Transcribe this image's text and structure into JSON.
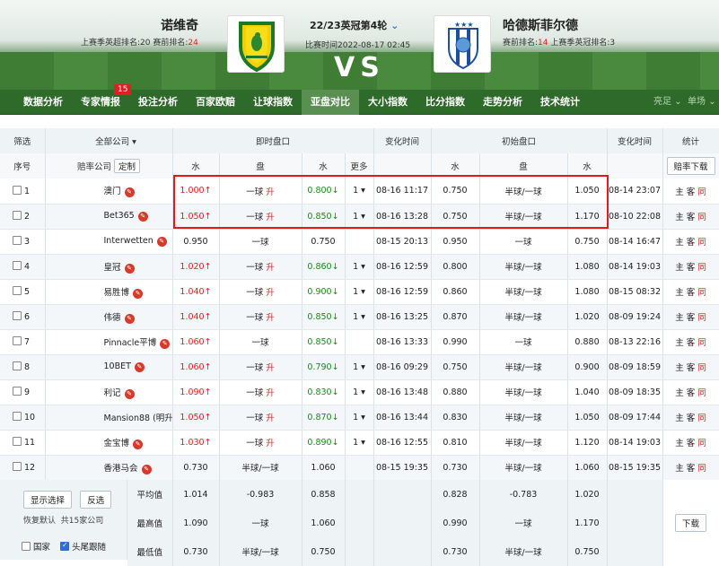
{
  "header": {
    "home_team": "诺维奇",
    "home_rank_prefix": "上赛季英超排名:20",
    "home_rank_label": "赛前排名:",
    "home_rank_value": "24",
    "away_team": "哈德斯菲尔德",
    "away_rank_label": "赛前排名:",
    "away_rank_value": "14",
    "away_rank_suffix": "上赛季英冠排名:3",
    "match_title": "22/23英冠第4轮",
    "match_time": "比赛时间2022-08-17 02:45",
    "vs": "VS"
  },
  "nav": {
    "items": [
      "数据分析",
      "专家情报",
      "投注分析",
      "百家欧赔",
      "让球指数",
      "亚盘对比",
      "大小指数",
      "比分指数",
      "走势分析",
      "技术统计"
    ],
    "active_index": 5,
    "badge": "15",
    "right_1": "亮足",
    "right_2": "单场"
  },
  "table": {
    "h_filter": "筛选",
    "h_company_select": "全部公司",
    "h_live": "即时盘口",
    "h_change_time": "变化时间",
    "h_initial": "初始盘口",
    "h_change_time2": "变化时间",
    "h_stats": "统计",
    "h_no": "序号",
    "h_company": "赔率公司",
    "h_custom": "定制",
    "h_water": "水",
    "h_handicap": "盘",
    "h_water2": "水",
    "h_more": "更多",
    "h_water3": "水",
    "h_handicap2": "盘",
    "h_water4": "水",
    "h_download": "赔率下载",
    "rows": [
      {
        "no": "1",
        "company": "澳门",
        "w1": "1.000↑",
        "p": "一球",
        "p_arrow": "升",
        "w2": "0.800↓",
        "more": "1",
        "time": "08-16 11:17",
        "iw1": "0.750",
        "ip": "半球/一球",
        "iw2": "1.050",
        "itime": "08-14 23:07"
      },
      {
        "no": "2",
        "company": "Bet365",
        "w1": "1.050↑",
        "p": "一球",
        "p_arrow": "升",
        "w2": "0.850↓",
        "more": "1",
        "time": "08-16 13:28",
        "iw1": "0.750",
        "ip": "半球/一球",
        "iw2": "1.170",
        "itime": "08-10 22:08"
      },
      {
        "no": "3",
        "company": "Interwetten",
        "w1": "0.950",
        "p": "一球",
        "p_arrow": "",
        "w2": "0.750",
        "more": "",
        "time": "08-15 20:13",
        "iw1": "0.950",
        "ip": "一球",
        "iw2": "0.750",
        "itime": "08-14 16:47"
      },
      {
        "no": "4",
        "company": "皇冠",
        "w1": "1.020↑",
        "p": "一球",
        "p_arrow": "升",
        "w2": "0.860↓",
        "more": "1",
        "time": "08-16 12:59",
        "iw1": "0.800",
        "ip": "半球/一球",
        "iw2": "1.080",
        "itime": "08-14 19:03"
      },
      {
        "no": "5",
        "company": "易胜博",
        "w1": "1.040↑",
        "p": "一球",
        "p_arrow": "升",
        "w2": "0.900↓",
        "more": "1",
        "time": "08-16 12:59",
        "iw1": "0.860",
        "ip": "半球/一球",
        "iw2": "1.080",
        "itime": "08-15 08:32"
      },
      {
        "no": "6",
        "company": "伟德",
        "w1": "1.040↑",
        "p": "一球",
        "p_arrow": "升",
        "w2": "0.850↓",
        "more": "1",
        "time": "08-16 13:25",
        "iw1": "0.870",
        "ip": "半球/一球",
        "iw2": "1.020",
        "itime": "08-09 19:24"
      },
      {
        "no": "7",
        "company": "Pinnacle平博",
        "w1": "1.060↑",
        "p": "一球",
        "p_arrow": "",
        "w2": "0.850↓",
        "more": "",
        "time": "08-16 13:33",
        "iw1": "0.990",
        "ip": "一球",
        "iw2": "0.880",
        "itime": "08-13 22:16"
      },
      {
        "no": "8",
        "company": "10BET",
        "w1": "1.060↑",
        "p": "一球",
        "p_arrow": "升",
        "w2": "0.790↓",
        "more": "1",
        "time": "08-16 09:29",
        "iw1": "0.750",
        "ip": "半球/一球",
        "iw2": "0.900",
        "itime": "08-09 18:59"
      },
      {
        "no": "9",
        "company": "利记",
        "w1": "1.090↑",
        "p": "一球",
        "p_arrow": "升",
        "w2": "0.830↓",
        "more": "1",
        "time": "08-16 13:48",
        "iw1": "0.880",
        "ip": "半球/一球",
        "iw2": "1.040",
        "itime": "08-09 18:35"
      },
      {
        "no": "10",
        "company": "Mansion88 (明升)",
        "w1": "1.050↑",
        "p": "一球",
        "p_arrow": "升",
        "w2": "0.870↓",
        "more": "1",
        "time": "08-16 13:44",
        "iw1": "0.830",
        "ip": "半球/一球",
        "iw2": "1.050",
        "itime": "08-09 17:44"
      },
      {
        "no": "11",
        "company": "金宝博",
        "w1": "1.030↑",
        "p": "一球",
        "p_arrow": "升",
        "w2": "0.890↓",
        "more": "1",
        "time": "08-16 12:55",
        "iw1": "0.810",
        "ip": "半球/一球",
        "iw2": "1.120",
        "itime": "08-14 19:03"
      },
      {
        "no": "12",
        "company": "香港马会",
        "w1": "0.730",
        "p": "半球/一球",
        "p_arrow": "",
        "w2": "1.060",
        "more": "",
        "time": "08-15 19:35",
        "iw1": "0.730",
        "ip": "半球/一球",
        "iw2": "1.060",
        "itime": "08-15 19:35"
      }
    ],
    "row_actions": [
      "主",
      "客",
      "同"
    ],
    "footer": {
      "btn_show": "显示选择",
      "btn_invert": "反选",
      "restore": "恢复默认",
      "total": "共15家公司",
      "cb_country": "国家",
      "cb_tail": "头尾跟随",
      "avg_label": "平均值",
      "max_label": "最高值",
      "min_label": "最低值",
      "avg": [
        "1.014",
        "-0.983",
        "0.858",
        "0.828",
        "-0.783",
        "1.020"
      ],
      "max": [
        "1.090",
        "一球",
        "1.060",
        "0.990",
        "一球",
        "1.170"
      ],
      "min": [
        "0.730",
        "半球/一球",
        "0.750",
        "0.730",
        "半球/一球",
        "0.750"
      ],
      "download": "下载"
    }
  },
  "colors": {
    "up": "#e02020",
    "down": "#1a8a1a",
    "nav_bg": "#2e6b2a",
    "highlight": "#e01b1b"
  }
}
